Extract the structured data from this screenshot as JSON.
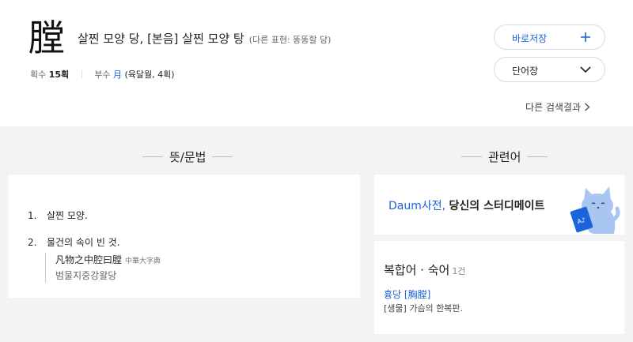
{
  "entry": {
    "hanja": "膛",
    "meaning": "살찐 모양 당, [본음] 살찐 모양 탕",
    "alt_expression": "(다른 표현: 똥똥할 당)",
    "stroke_label": "획수",
    "stroke_value": "15획",
    "radical_label": "부수",
    "radical_char": "月",
    "radical_detail": "(육달월, 4획)"
  },
  "actions": {
    "save_label": "바로저장",
    "vocab_label": "단어장",
    "other_results": "다른 검색결과"
  },
  "meaning_section": {
    "title": "뜻/문법",
    "items": [
      {
        "num": "1.",
        "text": "살찐 모양."
      },
      {
        "num": "2.",
        "text": "물건의 속이 빈 것."
      }
    ],
    "example": {
      "text": "凡物之中腔曰膛",
      "source": "中華大字典",
      "translation": "범물지중강왈당"
    }
  },
  "related_section": {
    "title": "관련어",
    "promo_brand": "Daum사전,",
    "promo_text": "당신의 스터디메이트",
    "compound_title": "복합어 · 숙어",
    "compound_count": "1건",
    "compounds": [
      {
        "word": "흉당 [胸膛]",
        "definition": "[생물] 가슴의 한복판."
      }
    ]
  },
  "colors": {
    "accent": "#1b64da",
    "background": "#f2f3f5",
    "panel": "#ffffff"
  }
}
